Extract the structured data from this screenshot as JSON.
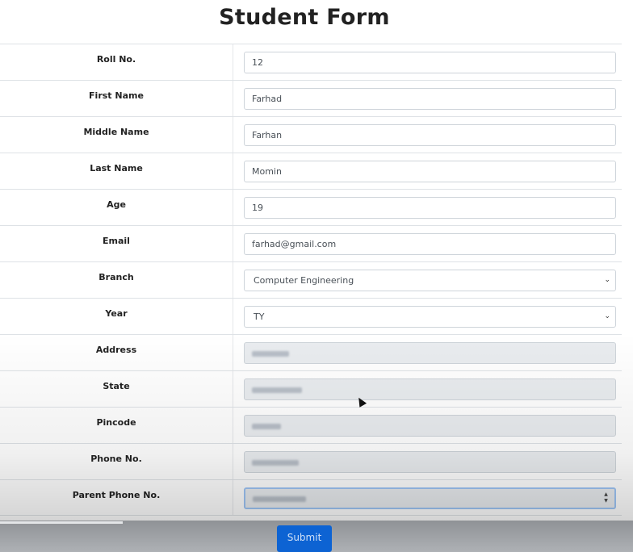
{
  "page": {
    "title": "Student Form"
  },
  "form": {
    "rows": [
      {
        "label": "Roll No.",
        "value": "12",
        "type": "text"
      },
      {
        "label": "First Name",
        "value": "Farhad",
        "type": "text"
      },
      {
        "label": "Middle Name",
        "value": "Farhan",
        "type": "text"
      },
      {
        "label": "Last Name",
        "value": "Momin",
        "type": "text"
      },
      {
        "label": "Age",
        "value": "19",
        "type": "text"
      },
      {
        "label": "Email",
        "value": "farhad@gmail.com",
        "type": "text"
      },
      {
        "label": "Branch",
        "value": "Computer Engineering",
        "type": "select"
      },
      {
        "label": "Year",
        "value": "TY",
        "type": "select"
      },
      {
        "label": "Address",
        "value": "",
        "type": "blurred"
      },
      {
        "label": "State",
        "value": "",
        "type": "blurred"
      },
      {
        "label": "Pincode",
        "value": "",
        "type": "blurred"
      },
      {
        "label": "Phone No.",
        "value": "",
        "type": "blurred"
      },
      {
        "label": "Parent Phone No.",
        "value": "",
        "type": "blurred-number"
      }
    ],
    "submit_label": "Submit"
  },
  "icons": {
    "select_arrow": "chevron-down-icon",
    "number_spinner": "spinner-icon",
    "mouse_cursor": "cursor-icon"
  },
  "colors": {
    "submit_button": "#0d63d3",
    "focus_border": "#9ec5f5"
  }
}
